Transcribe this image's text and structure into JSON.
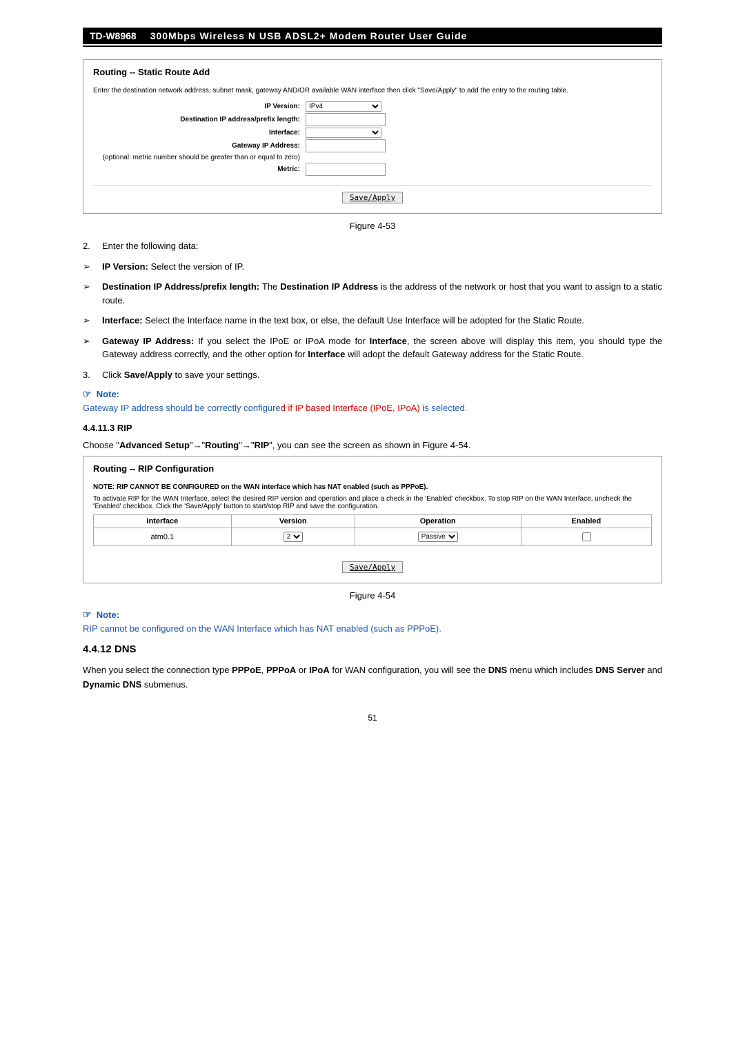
{
  "header": {
    "model": "TD-W8968",
    "title": "300Mbps  Wireless  N  USB  ADSL2+  Modem  Router  User  Guide"
  },
  "panel1": {
    "title": "Routing -- Static Route Add",
    "desc": "Enter the destination network address, subnet mask, gateway AND/OR available WAN interface then click \"Save/Apply\" to add the entry to the routing table.",
    "labels": {
      "ip_version": "IP Version:",
      "dest": "Destination IP address/prefix length:",
      "interface": "Interface:",
      "gateway": "Gateway IP Address:",
      "metric_note": "(optional: metric number should be greater than or equal to zero)",
      "metric": "Metric:"
    },
    "values": {
      "ip_version": "IPv4"
    },
    "save_apply": "Save/Apply"
  },
  "fig1": "Figure 4-53",
  "list1": {
    "item2_num": "2.",
    "item2_text": "Enter the following data:",
    "b1": "IP Version: ",
    "b1_rest": "Select the version of IP.",
    "b2": "Destination IP Address/prefix length: ",
    "b2_mid": "The ",
    "b2_bold": "Destination IP Address",
    "b2_rest": " is the address of the network or host that you want to assign to a static route.",
    "b3": "Interface: ",
    "b3_rest": "Select the Interface name in the text box, or else, the default Use Interface will be adopted for the Static Route.",
    "b4": "Gateway IP Address: ",
    "b4_mid": "  If you select the IPoE or IPoA mode for ",
    "b4_bold": "Interface",
    "b4_rest1": ", the screen above will display this item, you should type the Gateway address correctly, and the other option for ",
    "b4_bold2": "Interface",
    "b4_rest2": " will adopt the default Gateway address for the Static Route.",
    "item3_num": "3.",
    "item3_text_a": "Click ",
    "item3_text_b": "Save/Apply",
    "item3_text_c": " to save your settings."
  },
  "note1": {
    "head": "Note:",
    "body_s1": "Gateway IP address should be correctly configure",
    "body_s2": "d if IP based Interface (IPoE, IPoA) i",
    "body_s3": "s selected."
  },
  "rip_section": {
    "num": "4.4.11.3  RIP",
    "intro_a": "Choose \"",
    "intro_b": "Advanced Setup",
    "intro_c": "\"",
    "intro_d": "\"",
    "intro_e": "Routing",
    "intro_f": "\"",
    "intro_g": "\"",
    "intro_h": "RIP",
    "intro_i": "\", you can see the screen as shown in Figure 4-54."
  },
  "panel2": {
    "title": "Routing -- RIP Configuration",
    "note_bold": "NOTE: RIP CANNOT BE CONFIGURED on the WAN interface which has NAT enabled (such as PPPoE).",
    "note": "To activate RIP for the WAN Interface, select the desired RIP version and operation and place a check in the 'Enabled' checkbox. To stop RIP on the WAN Interface, uncheck the 'Enabled' checkbox. Click the 'Save/Apply' button to start/stop RIP and save the configuration.",
    "th": {
      "interface": "Interface",
      "version": "Version",
      "operation": "Operation",
      "enabled": "Enabled"
    },
    "row": {
      "interface": "atm0.1",
      "version": "2",
      "operation": "Passive"
    },
    "save_apply": "Save/Apply"
  },
  "fig2": "Figure 4-54",
  "note2": {
    "head": "Note:",
    "body": "RIP cannot be configured on the WAN Interface which has NAT enabled (such as PPPoE)."
  },
  "dns": {
    "heading": "4.4.12 DNS",
    "p_a": "When you select the connection type ",
    "p_b1": "PPPoE",
    "p_c1": ", ",
    "p_b2": "PPPoA",
    "p_c2": " or ",
    "p_b3": "IPoA",
    "p_c3": " for WAN configuration, you will see the ",
    "p_b4": "DNS",
    "p_c4": " menu which includes ",
    "p_b5": "DNS Server",
    "p_c5": " and ",
    "p_b6": "Dynamic DNS",
    "p_c6": " submenus."
  },
  "page_number": "51"
}
